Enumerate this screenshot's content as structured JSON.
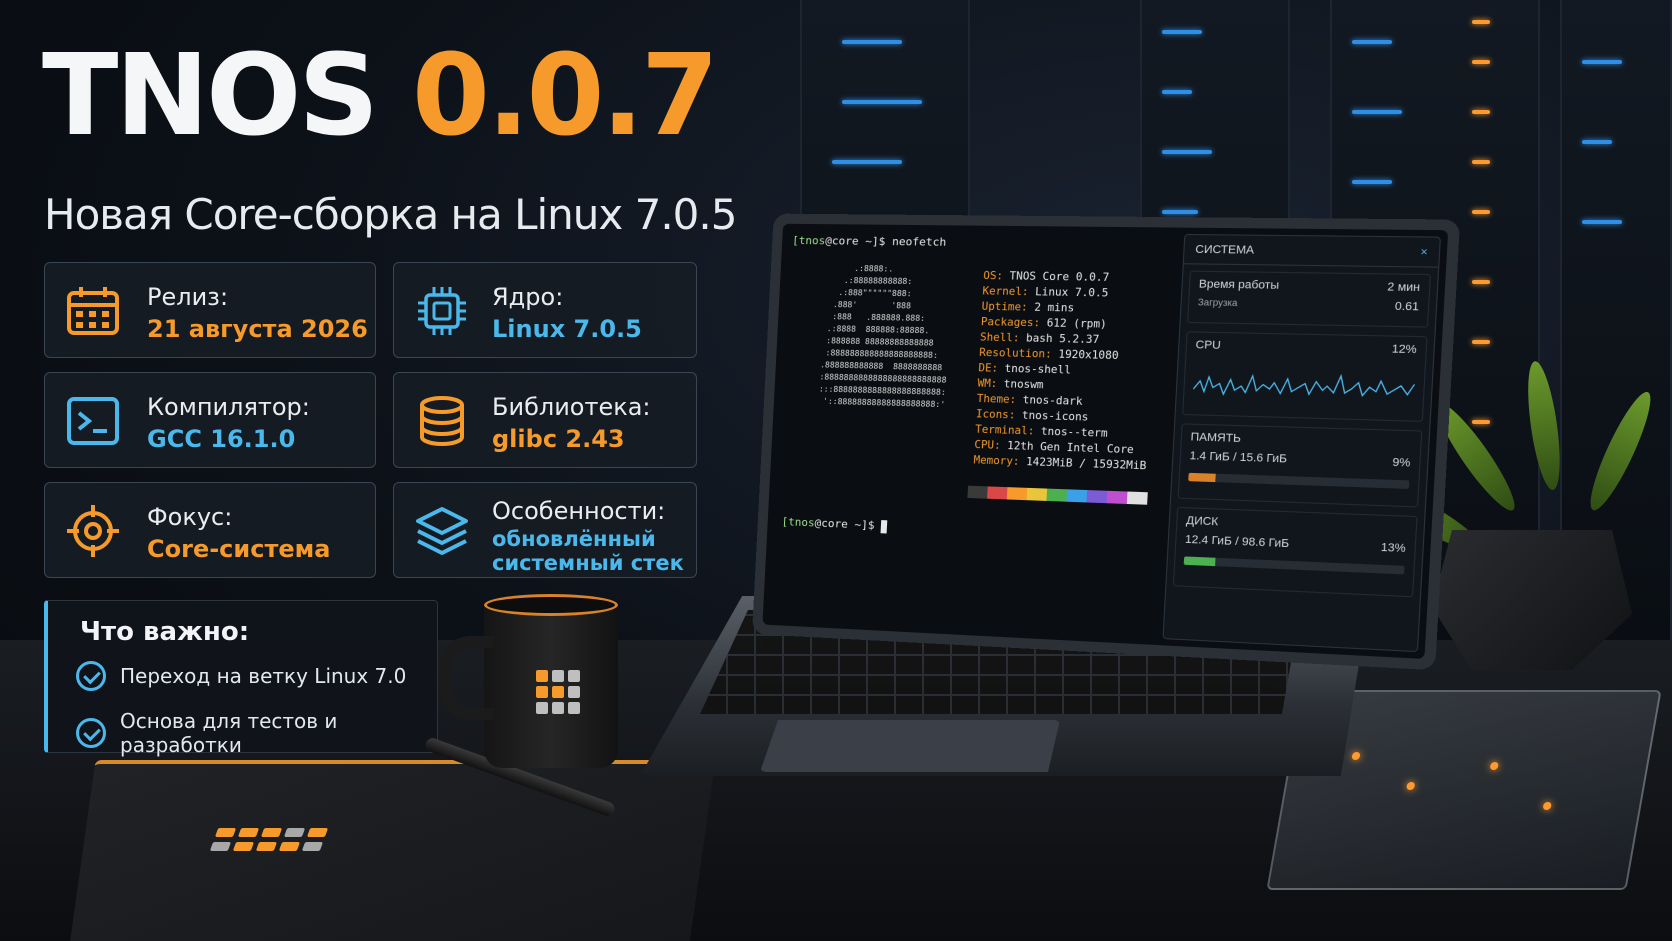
{
  "title": {
    "name": "TNOS",
    "version": "0.0.7"
  },
  "subtitle": "Новая Core-сборка на Linux 7.0.5",
  "cards": {
    "release": {
      "label": "Релиз:",
      "value": "21 августа 2026"
    },
    "kernel": {
      "label": "Ядро:",
      "value": "Linux 7.0.5"
    },
    "compiler": {
      "label": "Компилятор:",
      "value": "GCC 16.1.0"
    },
    "library": {
      "label": "Библиотека:",
      "value": "glibc 2.43"
    },
    "focus": {
      "label": "Фокус:",
      "value": "Core-система"
    },
    "features": {
      "label": "Особенности:",
      "value_line1": "обновлённый",
      "value_line2": "системный стек"
    }
  },
  "important": {
    "heading": "Что важно:",
    "items": [
      "Переход на ветку Linux 7.0",
      "Основа для тестов и разработки"
    ]
  },
  "terminal": {
    "prompt_user": "[tnos",
    "prompt_host": "@core ~]$",
    "command": "neofetch",
    "info": [
      {
        "k": "OS:",
        "v": "TNOS Core 0.0.7"
      },
      {
        "k": "Kernel:",
        "v": "Linux 7.0.5"
      },
      {
        "k": "Uptime:",
        "v": "2 mins"
      },
      {
        "k": "Packages:",
        "v": "612 (rpm)"
      },
      {
        "k": "Shell:",
        "v": "bash 5.2.37"
      },
      {
        "k": "Resolution:",
        "v": "1920x1080"
      },
      {
        "k": "DE:",
        "v": "tnos-shell"
      },
      {
        "k": "WM:",
        "v": "tnoswm"
      },
      {
        "k": "Theme:",
        "v": "tnos-dark"
      },
      {
        "k": "Icons:",
        "v": "tnos-icons"
      },
      {
        "k": "Terminal:",
        "v": "tnos--term"
      },
      {
        "k": "CPU:",
        "v": "12th Gen Intel Core"
      },
      {
        "k": "Memory:",
        "v": "1423MiB / 15932MiB"
      }
    ],
    "palette": [
      "#3a3a3a",
      "#d94848",
      "#f59a2b",
      "#e8c53a",
      "#4caf50",
      "#3aa0e8",
      "#7b5cd6",
      "#c04fd0",
      "#e0e0e0"
    ]
  },
  "panel": {
    "title": "СИСТЕМА",
    "close": "×",
    "uptime_label": "Время работы",
    "uptime_value": "2 мин",
    "load_label": "Загрузка",
    "load_value": "0.61",
    "cpu_label": "CPU",
    "cpu_value": "12%",
    "mem_label": "ПАМЯТЬ",
    "mem_detail": "1.4 ГиБ / 15.6 ГиБ",
    "mem_value": "9%",
    "mem_fraction": 0.09,
    "disk_label": "ДИСК",
    "disk_detail": "12.4 ГиБ / 98.6 ГиБ",
    "disk_value": "13%",
    "disk_fraction": 0.13
  },
  "colors": {
    "accent_orange": "#f59a2b",
    "accent_blue": "#4bb8ec",
    "mem_bar": "#d9822a",
    "disk_bar": "#4caf50"
  }
}
